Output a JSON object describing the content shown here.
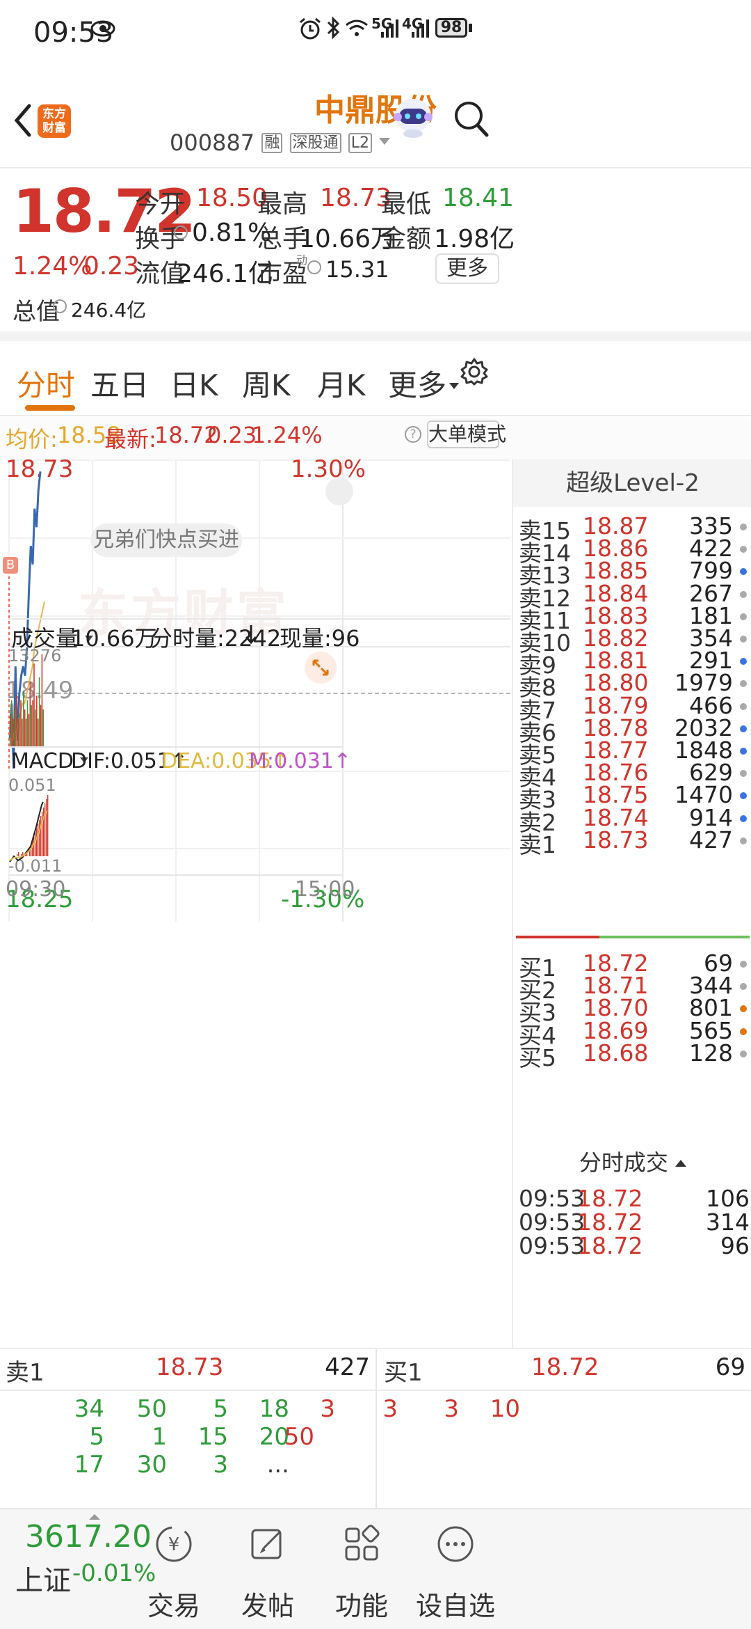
{
  "status_bar": {
    "time": "09:53",
    "battery": "98",
    "net1": "5G",
    "net2": "4G"
  },
  "header": {
    "title": "中鼎股份",
    "code": "000887",
    "tags": [
      "融",
      "深股通",
      "L2"
    ],
    "logo_line1": "东方",
    "logo_line2": "财富"
  },
  "quote": {
    "price": "18.72",
    "change_pct": "1.24%",
    "change": "0.23",
    "open_label": "今开",
    "open": "18.50",
    "high_label": "最高",
    "high": "18.73",
    "low_label": "最低",
    "low": "18.41",
    "turnover_label": "换手",
    "turnover": "0.81%",
    "volume_label": "总手",
    "volume": "10.66万",
    "amount_label": "金额",
    "amount": "1.98亿",
    "mktcap_label": "总值",
    "mktcap": "246.4亿",
    "float_label": "流值",
    "float_cap": "246.1亿",
    "pe_label": "市盈",
    "pe_sup": "动",
    "pe": "15.31",
    "more_button": "更多"
  },
  "tabs": [
    "分时",
    "五日",
    "日K",
    "周K",
    "月K",
    "更多"
  ],
  "avg_bar": {
    "avg_label": "均价:",
    "avg": "18.58",
    "last_label": "最新:",
    "last": "18.72",
    "chg": "0.23",
    "pct": "1.24%",
    "mode_button": "大单模式",
    "help": "?"
  },
  "chart": {
    "y_top": "18.73",
    "y_mid": "18.49",
    "y_bottom": "18.25",
    "pct_top": "1.30%",
    "pct_bottom": "-1.30%",
    "watermark": "东方财富",
    "bubble": "兄弟们快点买进",
    "marker": "B",
    "x_start": "09:30",
    "x_end": "15:00"
  },
  "chart_data": {
    "type": "line",
    "series": [
      {
        "values": [
          18.43,
          18.47,
          18.4,
          18.51,
          18.43,
          18.48,
          18.5,
          18.51,
          18.5,
          18.53,
          18.59,
          18.64,
          18.62,
          18.68,
          18.66,
          18.7,
          18.72
        ]
      },
      {
        "values": [
          18.43,
          18.44,
          18.44,
          18.45,
          18.46,
          18.47,
          18.47,
          18.48,
          18.49,
          18.5,
          18.51,
          18.53,
          18.54,
          18.55,
          18.56,
          18.57,
          18.58
        ]
      }
    ],
    "ylim": [
      18.25,
      18.73
    ],
    "volume": {
      "max": "13276",
      "bars": [
        0.35,
        0.5,
        0.3,
        0.45,
        0.4,
        0.55,
        0.3,
        0.35,
        0.5,
        0.3,
        0.6,
        0.4,
        0.3,
        0.5,
        0.35,
        0.7,
        0.45,
        0.5,
        0.9,
        0.4,
        0.55,
        0.3,
        0.75,
        0.45,
        1.0,
        0.4
      ]
    },
    "macd": {
      "top": "0.051",
      "bottom": "-0.011"
    }
  },
  "volume_bar": {
    "label": "成交量",
    "total": "10.66万",
    "tick_label": "分时量:2242",
    "now_label": "现量:96"
  },
  "macd_bar": {
    "label": "MACD",
    "dif": "DIF:0.051",
    "dea": "DEA:0.035",
    "m": "M:0.031"
  },
  "order_book": {
    "title": "超级Level-2",
    "asks": [
      {
        "label": "卖15",
        "price": "18.87",
        "vol": "335",
        "c": "g"
      },
      {
        "label": "卖14",
        "price": "18.86",
        "vol": "422",
        "c": "g"
      },
      {
        "label": "卖13",
        "price": "18.85",
        "vol": "799",
        "c": "b"
      },
      {
        "label": "卖12",
        "price": "18.84",
        "vol": "267",
        "c": "g"
      },
      {
        "label": "卖11",
        "price": "18.83",
        "vol": "181",
        "c": "g"
      },
      {
        "label": "卖10",
        "price": "18.82",
        "vol": "354",
        "c": "g"
      },
      {
        "label": "卖9",
        "price": "18.81",
        "vol": "291",
        "c": "b"
      },
      {
        "label": "卖8",
        "price": "18.80",
        "vol": "1979",
        "c": "g"
      },
      {
        "label": "卖7",
        "price": "18.79",
        "vol": "466",
        "c": "g"
      },
      {
        "label": "卖6",
        "price": "18.78",
        "vol": "2032",
        "c": "b"
      },
      {
        "label": "卖5",
        "price": "18.77",
        "vol": "1848",
        "c": "b"
      },
      {
        "label": "卖4",
        "price": "18.76",
        "vol": "629",
        "c": "g"
      },
      {
        "label": "卖3",
        "price": "18.75",
        "vol": "1470",
        "c": "b"
      },
      {
        "label": "卖2",
        "price": "18.74",
        "vol": "914",
        "c": "b"
      },
      {
        "label": "卖1",
        "price": "18.73",
        "vol": "427",
        "c": "g"
      }
    ],
    "bids": [
      {
        "label": "买1",
        "price": "18.72",
        "vol": "69",
        "c": "g"
      },
      {
        "label": "买2",
        "price": "18.71",
        "vol": "344",
        "c": "g"
      },
      {
        "label": "买3",
        "price": "18.70",
        "vol": "801",
        "c": "o"
      },
      {
        "label": "买4",
        "price": "18.69",
        "vol": "565",
        "c": "o"
      },
      {
        "label": "买5",
        "price": "18.68",
        "vol": "128",
        "c": "g"
      }
    ],
    "trades_title": "分时成交",
    "trades": [
      {
        "time": "09:53",
        "price": "18.72",
        "vol": "106"
      },
      {
        "time": "09:53",
        "price": "18.72",
        "vol": "314"
      },
      {
        "time": "09:53",
        "price": "18.72",
        "vol": "96"
      }
    ]
  },
  "queue": {
    "sell_label": "卖1",
    "sell_price": "18.73",
    "sell_total": "427",
    "buy_label": "买1",
    "buy_price": "18.72",
    "buy_total": "69",
    "sell_orders": [
      "34",
      "50",
      "5",
      "18",
      "5",
      "1",
      "15",
      "20",
      "17",
      "30",
      "3",
      "..."
    ],
    "buy_orders": [
      "3",
      "3",
      "3",
      "10",
      "50"
    ]
  },
  "bottom": {
    "index_value": "3617.20",
    "index_name": "上证",
    "index_pct": "-0.01%",
    "nav": [
      "交易",
      "发帖",
      "功能",
      "设自选"
    ]
  }
}
